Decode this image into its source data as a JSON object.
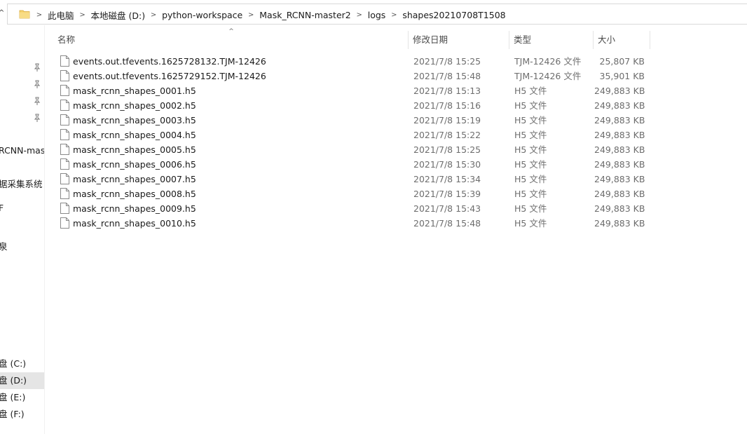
{
  "address_bar": {
    "breadcrumbs": [
      "此电脑",
      "本地磁盘 (D:)",
      "python-workspace",
      "Mask_RCNN-master2",
      "logs",
      "shapes20210708T1508"
    ]
  },
  "columns": {
    "name": "名称",
    "date": "修改日期",
    "type": "类型",
    "size": "大小"
  },
  "files": [
    {
      "name": "events.out.tfevents.1625728132.TJM-12426",
      "date": "2021/7/8 15:25",
      "type": "TJM-12426 文件",
      "size": "25,807 KB"
    },
    {
      "name": "events.out.tfevents.1625729152.TJM-12426",
      "date": "2021/7/8 15:48",
      "type": "TJM-12426 文件",
      "size": "35,901 KB"
    },
    {
      "name": "mask_rcnn_shapes_0001.h5",
      "date": "2021/7/8 15:13",
      "type": "H5 文件",
      "size": "249,883 KB"
    },
    {
      "name": "mask_rcnn_shapes_0002.h5",
      "date": "2021/7/8 15:16",
      "type": "H5 文件",
      "size": "249,883 KB"
    },
    {
      "name": "mask_rcnn_shapes_0003.h5",
      "date": "2021/7/8 15:19",
      "type": "H5 文件",
      "size": "249,883 KB"
    },
    {
      "name": "mask_rcnn_shapes_0004.h5",
      "date": "2021/7/8 15:22",
      "type": "H5 文件",
      "size": "249,883 KB"
    },
    {
      "name": "mask_rcnn_shapes_0005.h5",
      "date": "2021/7/8 15:25",
      "type": "H5 文件",
      "size": "249,883 KB"
    },
    {
      "name": "mask_rcnn_shapes_0006.h5",
      "date": "2021/7/8 15:30",
      "type": "H5 文件",
      "size": "249,883 KB"
    },
    {
      "name": "mask_rcnn_shapes_0007.h5",
      "date": "2021/7/8 15:34",
      "type": "H5 文件",
      "size": "249,883 KB"
    },
    {
      "name": "mask_rcnn_shapes_0008.h5",
      "date": "2021/7/8 15:39",
      "type": "H5 文件",
      "size": "249,883 KB"
    },
    {
      "name": "mask_rcnn_shapes_0009.h5",
      "date": "2021/7/8 15:43",
      "type": "H5 文件",
      "size": "249,883 KB"
    },
    {
      "name": "mask_rcnn_shapes_0010.h5",
      "date": "2021/7/8 15:48",
      "type": "H5 文件",
      "size": "249,883 KB"
    }
  ],
  "nav_pane": {
    "project_folder": "RCNN-mas",
    "app_folder": "据采集系统",
    "partial_a": "F",
    "partial_b": "泉",
    "drives": [
      "盘 (C:)",
      "盘 (D:)",
      "盘 (E:)",
      "盘 (F:)"
    ],
    "selected_drive_index": 1
  },
  "icons": {
    "address_folder": "folder-icon",
    "file": "document-icon",
    "quick_access_pin": "pin-icon",
    "breadcrumb_separator": "chevron-right-icon"
  },
  "colors": {
    "folder_yellow": "#f6d16b",
    "selected_bg": "#e5e5e5",
    "secondary_text": "#6d6d6d"
  }
}
